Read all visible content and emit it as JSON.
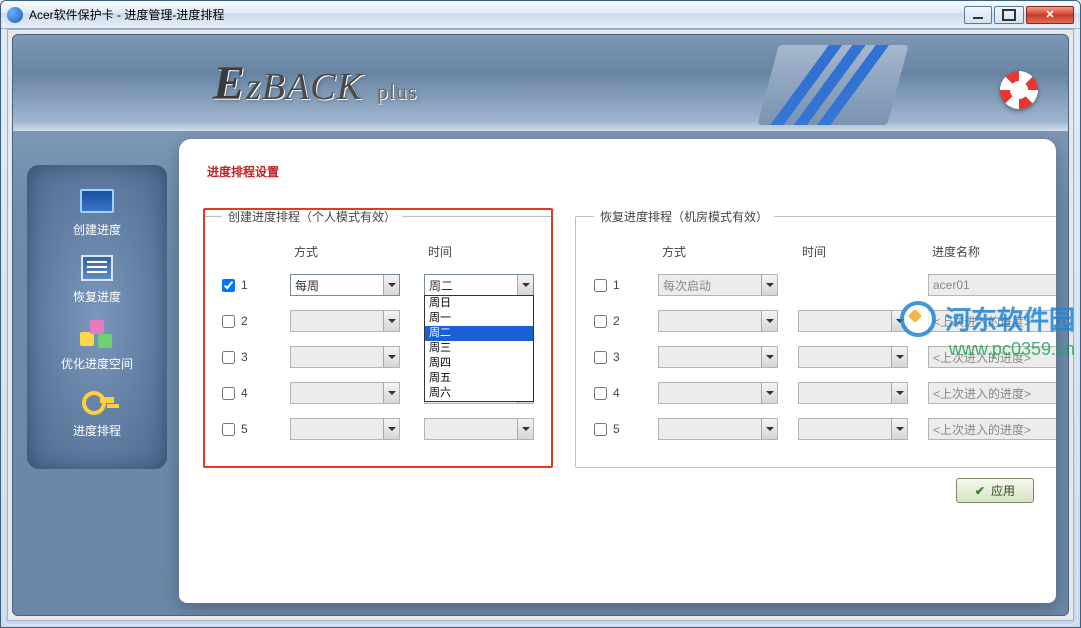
{
  "window": {
    "title": "Acer软件保护卡 - 进度管理-进度排程"
  },
  "logo": {
    "brand_prefix": "E",
    "brand_mid": "zBACK",
    "brand_suffix": "plus"
  },
  "sidenav": {
    "items": [
      {
        "label": "创建进度"
      },
      {
        "label": "恢复进度"
      },
      {
        "label": "优化进度空间"
      },
      {
        "label": "进度排程"
      }
    ]
  },
  "section_title": "进度排程设置",
  "create_panel": {
    "legend": "创建进度排程（个人模式有效）",
    "col_method": "方式",
    "col_time": "时间",
    "rows": [
      {
        "n": "1",
        "checked": true,
        "method": "每周",
        "time": "周二"
      },
      {
        "n": "2",
        "checked": false,
        "method": "",
        "time": ""
      },
      {
        "n": "3",
        "checked": false,
        "method": "",
        "time": ""
      },
      {
        "n": "4",
        "checked": false,
        "method": "",
        "time": ""
      },
      {
        "n": "5",
        "checked": false,
        "method": "",
        "time": ""
      }
    ],
    "open_dropdown": {
      "options": [
        "周日",
        "周一",
        "周二",
        "周三",
        "周四",
        "周五",
        "周六"
      ],
      "selected": "周二"
    }
  },
  "recover_panel": {
    "legend": "恢复进度排程（机房模式有效）",
    "col_method": "方式",
    "col_time": "时间",
    "col_name": "进度名称",
    "rows": [
      {
        "n": "1",
        "checked": false,
        "method": "每次启动",
        "time": "",
        "name": "acer01"
      },
      {
        "n": "2",
        "checked": false,
        "method": "",
        "time": "",
        "name": "<上次进入的进度>"
      },
      {
        "n": "3",
        "checked": false,
        "method": "",
        "time": "",
        "name": "<上次进入的进度>"
      },
      {
        "n": "4",
        "checked": false,
        "method": "",
        "time": "",
        "name": "<上次进入的进度>"
      },
      {
        "n": "5",
        "checked": false,
        "method": "",
        "time": "",
        "name": "<上次进入的进度>"
      }
    ]
  },
  "apply_button": "应用",
  "watermark": {
    "cn": "河东软件园",
    "url": "www.pc0359.cn"
  }
}
